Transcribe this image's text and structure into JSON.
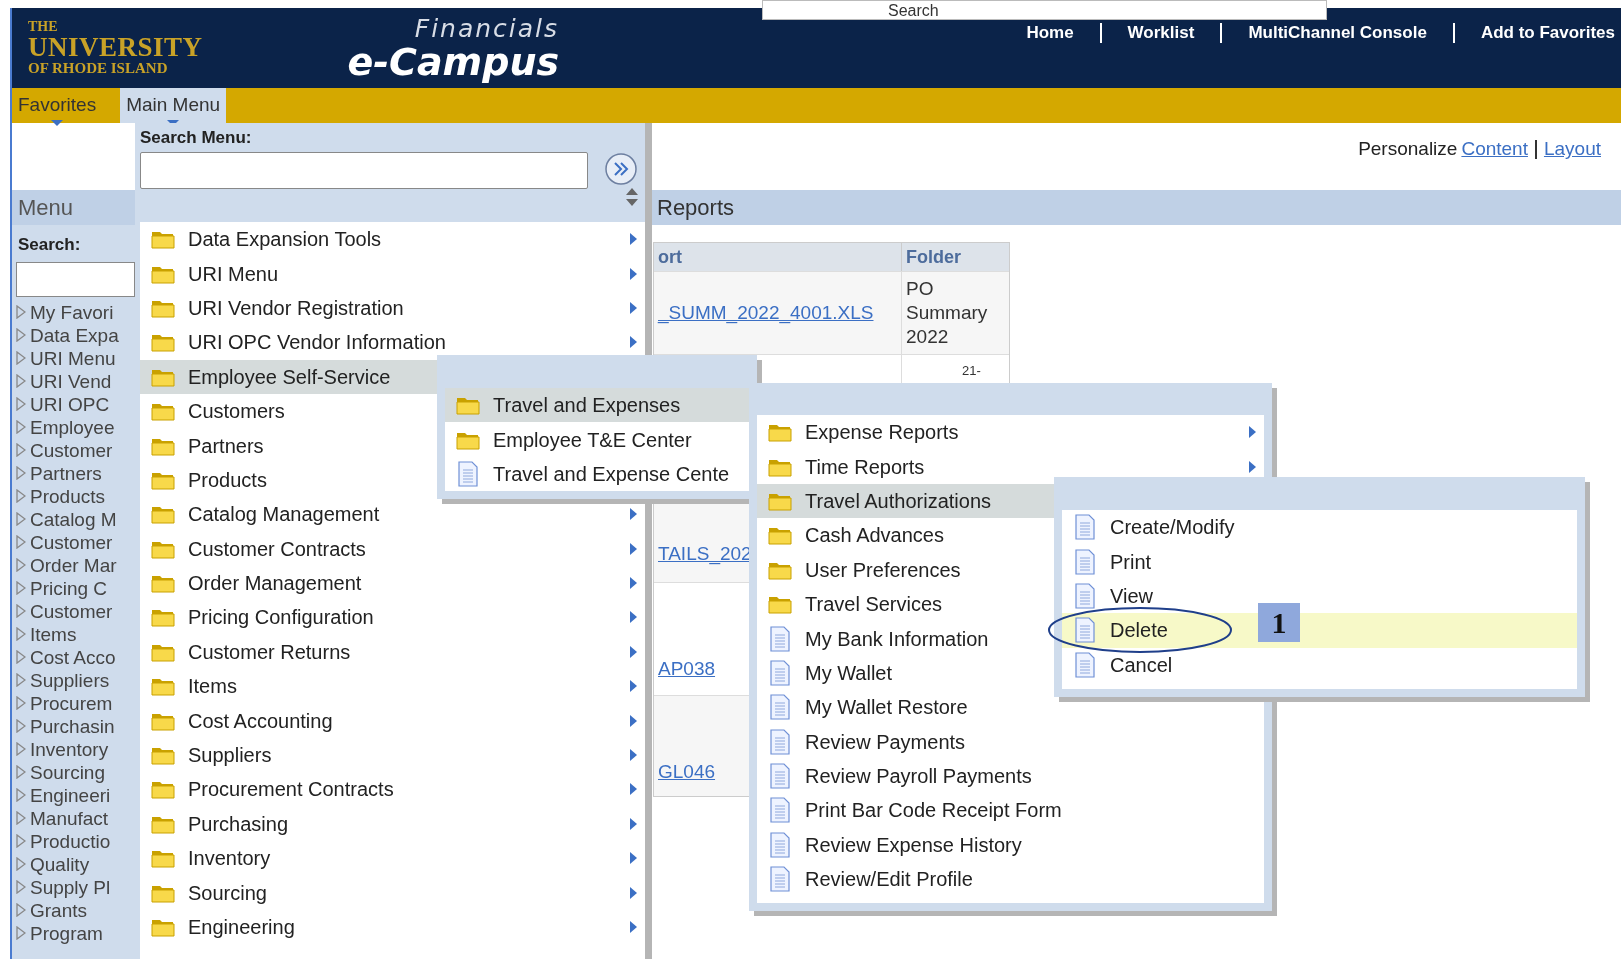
{
  "header": {
    "logo": {
      "line_1": "THE",
      "line_2": "UNIVERSITY",
      "line_3": "OF RHODE ISLAND"
    },
    "app_title": "Financials",
    "app_name": "e-Campus",
    "search": {
      "placeholder": "Search"
    },
    "nav_links": [
      "Home",
      "Worklist",
      "MultiChannel Console",
      "Add to Favorites"
    ]
  },
  "menu_bar": {
    "tabs": [
      {
        "label": "Favorites",
        "selected": false
      },
      {
        "label": "Main Menu",
        "selected": true
      }
    ]
  },
  "sidebar": {
    "title": "Menu",
    "search_label": "Search:",
    "items": [
      "My Favori",
      "Data Expa",
      "URI Menu",
      "URI Vend",
      "URI OPC",
      "Employee",
      "Customer",
      "Partners",
      "Products",
      "Catalog M",
      "Customer",
      "Order Mar",
      "Pricing C",
      "Customer",
      "Items",
      "Cost Acco",
      "Suppliers",
      "Procurem",
      "Purchasin",
      "Inventory",
      "Sourcing",
      "Engineeri",
      "Manufact",
      "Productio",
      "Quality",
      "Supply Pl",
      "Grants",
      "Program"
    ]
  },
  "personalize": {
    "label": "Personalize",
    "links": [
      "Content",
      "Layout"
    ]
  },
  "reports": {
    "title": "Reports",
    "columns": [
      "ort",
      "Folder"
    ],
    "rows": [
      {
        "report": "_SUMM_2022_4001.XLS",
        "folder": "PO Summary 2022"
      },
      {
        "folder": "21-"
      },
      {
        "report": "TAILS_202"
      },
      {
        "report": "AP038"
      },
      {
        "report": "GL046"
      }
    ]
  },
  "main_menu": {
    "search_label": "Search Menu:",
    "items": [
      {
        "label": "Data Expansion Tools",
        "kind": "folder",
        "arrow": true,
        "selected": false
      },
      {
        "label": "URI Menu",
        "kind": "folder",
        "arrow": true,
        "selected": false
      },
      {
        "label": "URI Vendor Registration",
        "kind": "folder",
        "arrow": true,
        "selected": false
      },
      {
        "label": "URI OPC Vendor Information",
        "kind": "folder",
        "arrow": true,
        "selected": false
      },
      {
        "label": "Employee Self-Service",
        "kind": "folder",
        "arrow": false,
        "selected": true
      },
      {
        "label": "Customers",
        "kind": "folder",
        "arrow": false,
        "selected": false
      },
      {
        "label": "Partners",
        "kind": "folder",
        "arrow": false,
        "selected": false
      },
      {
        "label": "Products",
        "kind": "folder",
        "arrow": false,
        "selected": false
      },
      {
        "label": "Catalog Management",
        "kind": "folder",
        "arrow": true,
        "selected": false
      },
      {
        "label": "Customer Contracts",
        "kind": "folder",
        "arrow": true,
        "selected": false
      },
      {
        "label": "Order Management",
        "kind": "folder",
        "arrow": true,
        "selected": false
      },
      {
        "label": "Pricing Configuration",
        "kind": "folder",
        "arrow": true,
        "selected": false
      },
      {
        "label": "Customer Returns",
        "kind": "folder",
        "arrow": true,
        "selected": false
      },
      {
        "label": "Items",
        "kind": "folder",
        "arrow": true,
        "selected": false
      },
      {
        "label": "Cost Accounting",
        "kind": "folder",
        "arrow": true,
        "selected": false
      },
      {
        "label": "Suppliers",
        "kind": "folder",
        "arrow": true,
        "selected": false
      },
      {
        "label": "Procurement Contracts",
        "kind": "folder",
        "arrow": true,
        "selected": false
      },
      {
        "label": "Purchasing",
        "kind": "folder",
        "arrow": true,
        "selected": false
      },
      {
        "label": "Inventory",
        "kind": "folder",
        "arrow": true,
        "selected": false
      },
      {
        "label": "Sourcing",
        "kind": "folder",
        "arrow": true,
        "selected": false
      },
      {
        "label": "Engineering",
        "kind": "folder",
        "arrow": true,
        "selected": false
      }
    ]
  },
  "submenus": [
    {
      "items": [
        {
          "label": "Travel and Expenses",
          "kind": "folder",
          "selected": true
        },
        {
          "label": "Employee T&E Center",
          "kind": "folder",
          "selected": false
        },
        {
          "label": "Travel and Expense Cente",
          "kind": "page",
          "selected": false
        }
      ]
    },
    {
      "items": [
        {
          "label": "Expense Reports",
          "kind": "folder",
          "arrow": true,
          "selected": false
        },
        {
          "label": "Time Reports",
          "kind": "folder",
          "arrow": true,
          "selected": false
        },
        {
          "label": "Travel Authorizations",
          "kind": "folder",
          "arrow": false,
          "selected": true
        },
        {
          "label": "Cash Advances",
          "kind": "folder",
          "arrow": false,
          "selected": false
        },
        {
          "label": "User Preferences",
          "kind": "folder",
          "arrow": false,
          "selected": false
        },
        {
          "label": "Travel Services",
          "kind": "folder",
          "arrow": false,
          "selected": false
        },
        {
          "label": "My Bank Information",
          "kind": "page",
          "arrow": false,
          "selected": false
        },
        {
          "label": "My Wallet",
          "kind": "page",
          "arrow": false,
          "selected": false
        },
        {
          "label": "My Wallet Restore",
          "kind": "page",
          "arrow": false,
          "selected": false
        },
        {
          "label": "Review Payments",
          "kind": "page",
          "arrow": false,
          "selected": false
        },
        {
          "label": "Review Payroll Payments",
          "kind": "page",
          "arrow": false,
          "selected": false
        },
        {
          "label": "Print Bar Code Receipt Form",
          "kind": "page",
          "arrow": false,
          "selected": false
        },
        {
          "label": "Review Expense History",
          "kind": "page",
          "arrow": false,
          "selected": false
        },
        {
          "label": "Review/Edit Profile",
          "kind": "page",
          "arrow": false,
          "selected": false
        }
      ]
    },
    {
      "items": [
        {
          "label": "Create/Modify",
          "kind": "page",
          "selected": false
        },
        {
          "label": "Print",
          "kind": "page",
          "selected": false
        },
        {
          "label": "View",
          "kind": "page",
          "selected": false
        },
        {
          "label": "Delete",
          "kind": "page",
          "selected": true,
          "callout": "1"
        },
        {
          "label": "Cancel",
          "kind": "page",
          "selected": false
        }
      ]
    }
  ]
}
